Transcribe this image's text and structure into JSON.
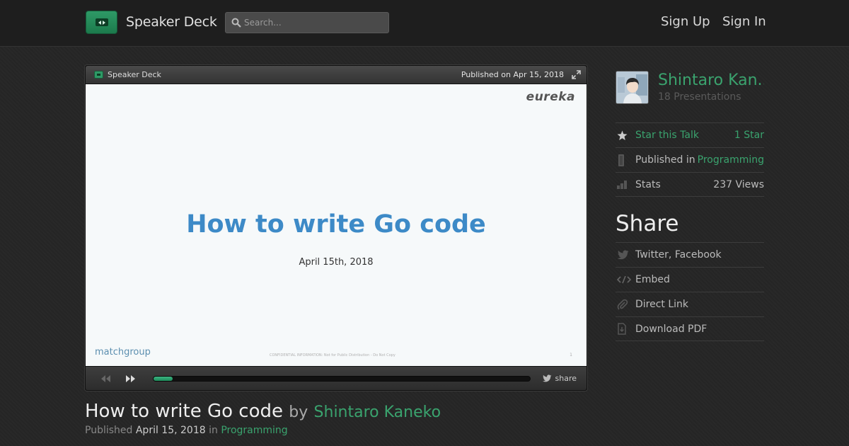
{
  "header": {
    "brand": "Speaker Deck",
    "search_placeholder": "Search...",
    "sign_up": "Sign Up",
    "sign_in": "Sign In"
  },
  "player": {
    "brand": "Speaker Deck",
    "published": "Published on Apr 15, 2018",
    "share_label": "share",
    "progress": 0.05
  },
  "slide": {
    "logo": "eureka",
    "title": "How to write Go code",
    "date": "April 15th, 2018",
    "footer_logo": "matchgroup",
    "confidential": "CONFIDENTIAL INFORMATION: Not for Public Distribution - Do Not Copy",
    "page_number": "1"
  },
  "talk": {
    "title": "How to write Go code",
    "by": "by",
    "author": "Shintaro Kaneko",
    "published_label": "Published",
    "published_date": "April 15, 2018",
    "in_label": "in",
    "category": "Programming"
  },
  "sidebar": {
    "author_name": "Shintaro Kan...",
    "presentations": "18 Presentations",
    "star_label": "Star this Talk",
    "star_count": "1 Star",
    "published_in_label": "Published in",
    "published_in_value": "Programming",
    "stats_label": "Stats",
    "stats_value": "237 Views",
    "share_heading": "Share",
    "share_items": {
      "twitter": "Twitter, Facebook",
      "embed": "Embed",
      "direct_link": "Direct Link",
      "download": "Download PDF"
    }
  },
  "colors": {
    "accent_green": "#3aa36e",
    "slide_title_blue": "#3d8ac7",
    "background": "#262626"
  }
}
